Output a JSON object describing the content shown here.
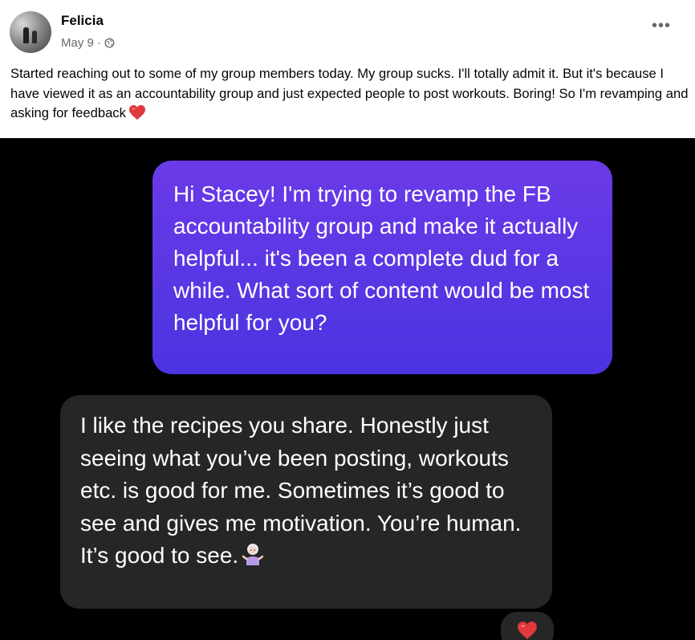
{
  "post": {
    "author": "Felicia",
    "date": "May 9",
    "separator": "·",
    "privacy_icon": "globe-icon",
    "more_icon": "more-options-icon",
    "text": "Started reaching out to some of my group members today. My group sucks. I'll totally admit it. But it's because I have viewed it as an accountability group and just expected people to post workouts. Boring! So I'm revamping and asking for feedback",
    "trailing_emoji": "red-heart-icon"
  },
  "chat": {
    "outgoing_message": "Hi Stacey! I'm trying to revamp the FB accountability group and make it actually helpful... it's been a complete dud for a while. What sort of content would be most helpful for you?",
    "incoming_message": "I like the recipes you share. Honestly just seeing what you’ve been posting, workouts etc. is good for me. Sometimes it’s good to see and gives me motivation. You’re human. It’s good to see.",
    "incoming_emoji": "woman-shrugging-icon",
    "reaction": "red-heart-icon"
  },
  "colors": {
    "outgoing_bubble": "#5a37e4",
    "incoming_bubble": "#262626",
    "chat_background": "#000000",
    "heart": "#e0393e"
  }
}
